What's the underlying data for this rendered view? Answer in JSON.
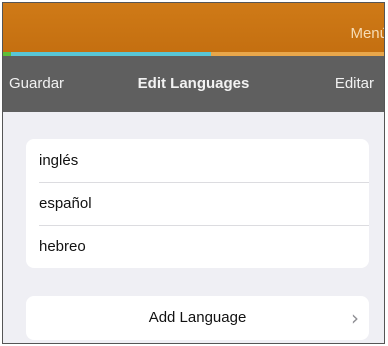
{
  "topbar": {
    "menu_label": "Menú"
  },
  "navbar": {
    "left_label": "Guardar",
    "title": "Edit Languages",
    "right_label": "Editar"
  },
  "languages": [
    "inglés",
    "español",
    "hebreo"
  ],
  "add_language": {
    "label": "Add Language",
    "chevron": "chevron-right-icon"
  },
  "colors": {
    "topbar": "#c87415",
    "navbar": "#5f5f5f",
    "background": "#efeff4",
    "strip": [
      "#5fbf3a",
      "#58c6d6",
      "#e8a64a"
    ]
  }
}
